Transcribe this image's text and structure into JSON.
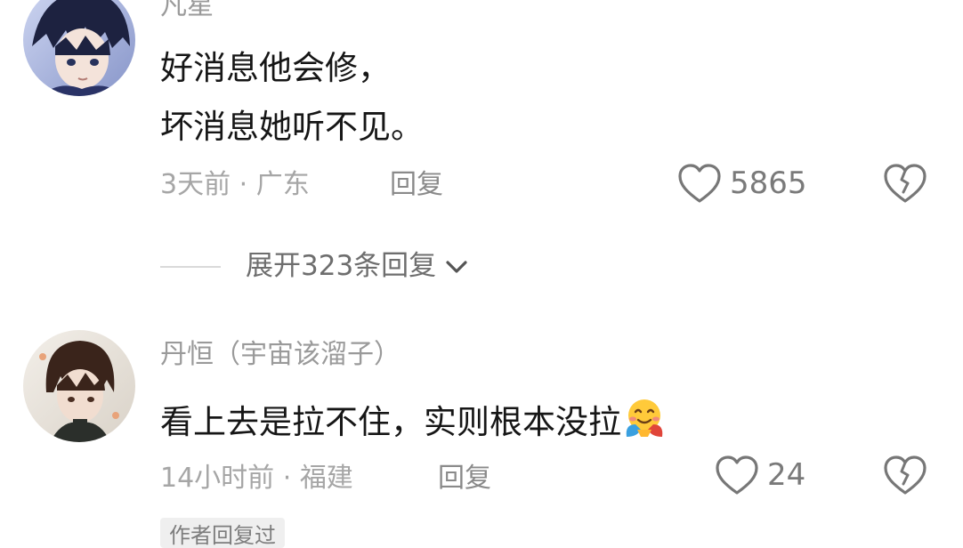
{
  "comments": [
    {
      "username": "凡星",
      "lines": [
        "好消息他会修，",
        "坏消息她听不见。"
      ],
      "time": "3天前",
      "location": "广东",
      "reply_label": "回复",
      "likes": "5865",
      "expand_label": "展开323条回复"
    },
    {
      "username": "丹恒（宇宙该溜子）",
      "lines": [
        "看上去是拉不住，实则根本没拉"
      ],
      "emoji": "smiling-face-with-hearts-hugging",
      "time": "14小时前",
      "location": "福建",
      "reply_label": "回复",
      "likes": "24",
      "badge": "作者回复过"
    }
  ],
  "colors": {
    "text_primary": "#161616",
    "text_secondary": "#9a9a9a",
    "icon_gray": "#777777"
  },
  "icons": [
    "heart-outline-icon",
    "broken-heart-icon",
    "chevron-down-icon"
  ]
}
